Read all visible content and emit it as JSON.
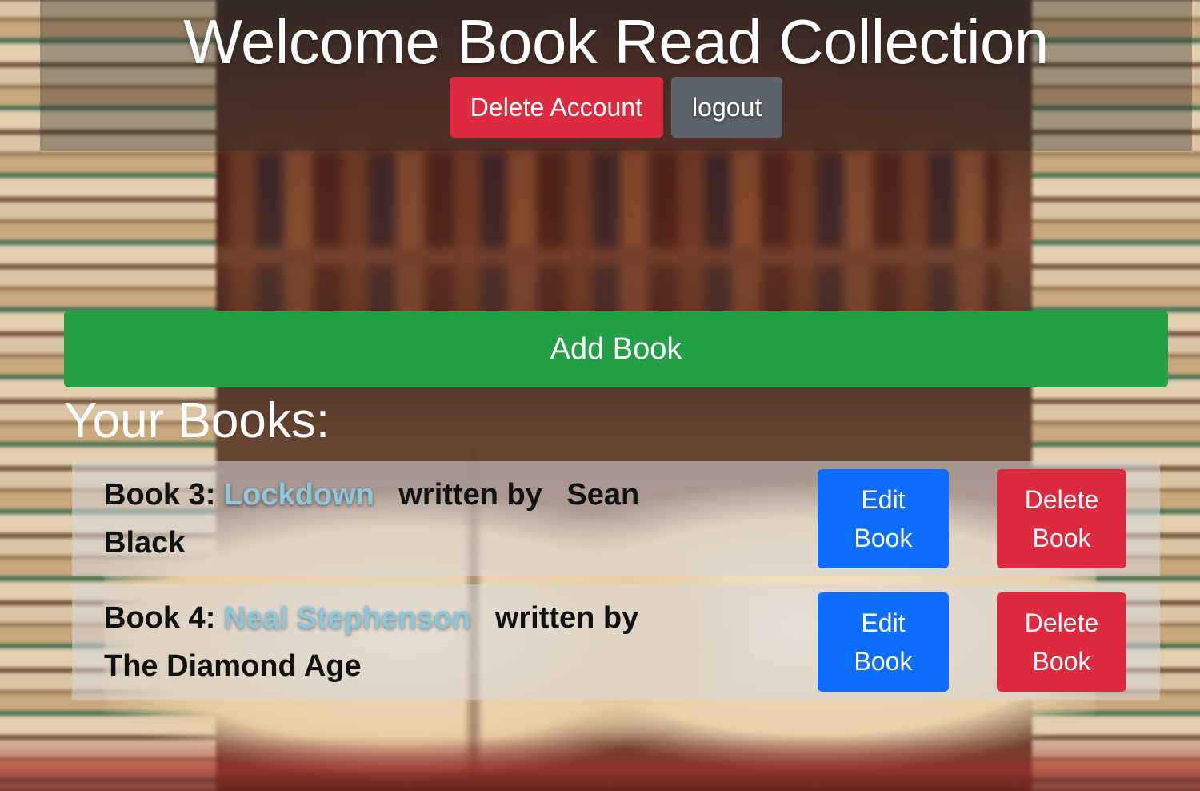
{
  "header": {
    "title": "Welcome Book Read Collection",
    "delete_account_label": "Delete Account",
    "logout_label": "logout"
  },
  "actions": {
    "add_book_label": "Add Book"
  },
  "books_section": {
    "title": "Your Books:",
    "books": [
      {
        "prefix": "Book 3:",
        "link_text": "Lockdown",
        "written_by": "written by",
        "trailing": "Sean Black",
        "edit_label_line1": "Edit",
        "edit_label_line2": "Book",
        "delete_label_line1": "Delete",
        "delete_label_line2": "Book"
      },
      {
        "prefix": "Book 4:",
        "link_text": "Neal Stephenson",
        "written_by": "written by",
        "trailing": "The Diamond Age",
        "edit_label_line1": "Edit",
        "edit_label_line2": "Book",
        "delete_label_line1": "Delete",
        "delete_label_line2": "Book"
      }
    ]
  },
  "colors": {
    "danger": "#dc2a3e",
    "secondary": "#5c636a",
    "primary": "#0d6efd",
    "success": "#23a045",
    "link": "#8ec6da"
  }
}
